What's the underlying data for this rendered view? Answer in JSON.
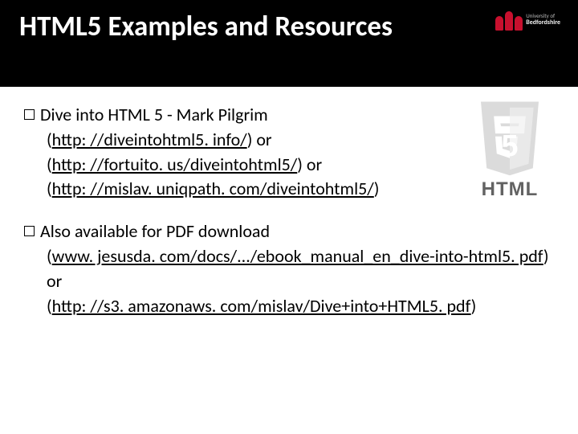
{
  "header": {
    "title": "HTML5 Examples and Resources",
    "university": {
      "line1": "University of",
      "line2": "Bedfordshire"
    }
  },
  "badge": {
    "label": "HTML"
  },
  "bullets": [
    {
      "lead": "Dive into HTML 5 - Mark Pilgrim",
      "lines": [
        {
          "prefix": "(",
          "link": "http: //diveintohtml5. info/",
          "suffix": ") or"
        },
        {
          "prefix": "(",
          "link": "http: //fortuito. us/diveintohtml5/",
          "suffix": ")  or"
        },
        {
          "prefix": "(",
          "link": "http: //mislav. uniqpath. com/diveintohtml5/",
          "suffix": ")"
        }
      ]
    },
    {
      "lead": "Also available for PDF download",
      "lines": [
        {
          "prefix": "(",
          "link": "www. jesusda. com/docs/.../ebook_manual_en_dive-into-html5. pdf",
          "suffix": ") or"
        },
        {
          "prefix": "(",
          "link": "http: //s3. amazonaws. com/mislav/Dive+into+HTML5. pdf",
          "suffix": ")"
        }
      ]
    }
  ]
}
